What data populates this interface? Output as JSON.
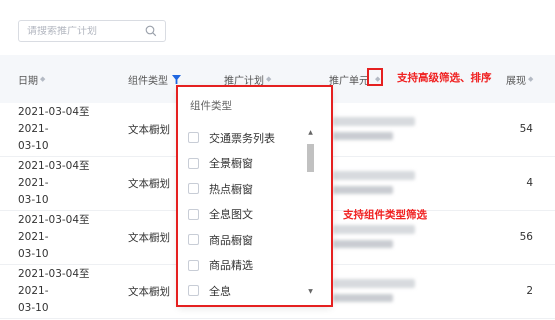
{
  "search": {
    "placeholder": "请搜索推广计划",
    "icon": "search-icon"
  },
  "columns": {
    "date": "日期",
    "component_type": "组件类型",
    "plan": "推广计划",
    "unit": "推广单元",
    "exposure": "展现"
  },
  "rows": [
    {
      "date_line1": "2021-03-04至2021-",
      "date_line2": "03-10",
      "type": "文本橱划",
      "value": "54"
    },
    {
      "date_line1": "2021-03-04至2021-",
      "date_line2": "03-10",
      "type": "文本橱划",
      "value": "4"
    },
    {
      "date_line1": "2021-03-04至2021-",
      "date_line2": "03-10",
      "type": "文本橱划",
      "value": "56"
    },
    {
      "date_line1": "2021-03-04至2021-",
      "date_line2": "03-10",
      "type": "文本橱划",
      "value": "2"
    }
  ],
  "filter_dropdown": {
    "title": "组件类型",
    "options": [
      "交通票务列表",
      "全景橱窗",
      "热点橱窗",
      "全息图文",
      "商品橱窗",
      "商品精选",
      "全息"
    ]
  },
  "annotations": {
    "sort_note": "支持高级筛选、排序",
    "filter_note": "支持组件类型筛选",
    "color": "#f02020"
  },
  "colors": {
    "filter_icon": "#1f66e0",
    "header_bg": "#f5f7fa"
  }
}
